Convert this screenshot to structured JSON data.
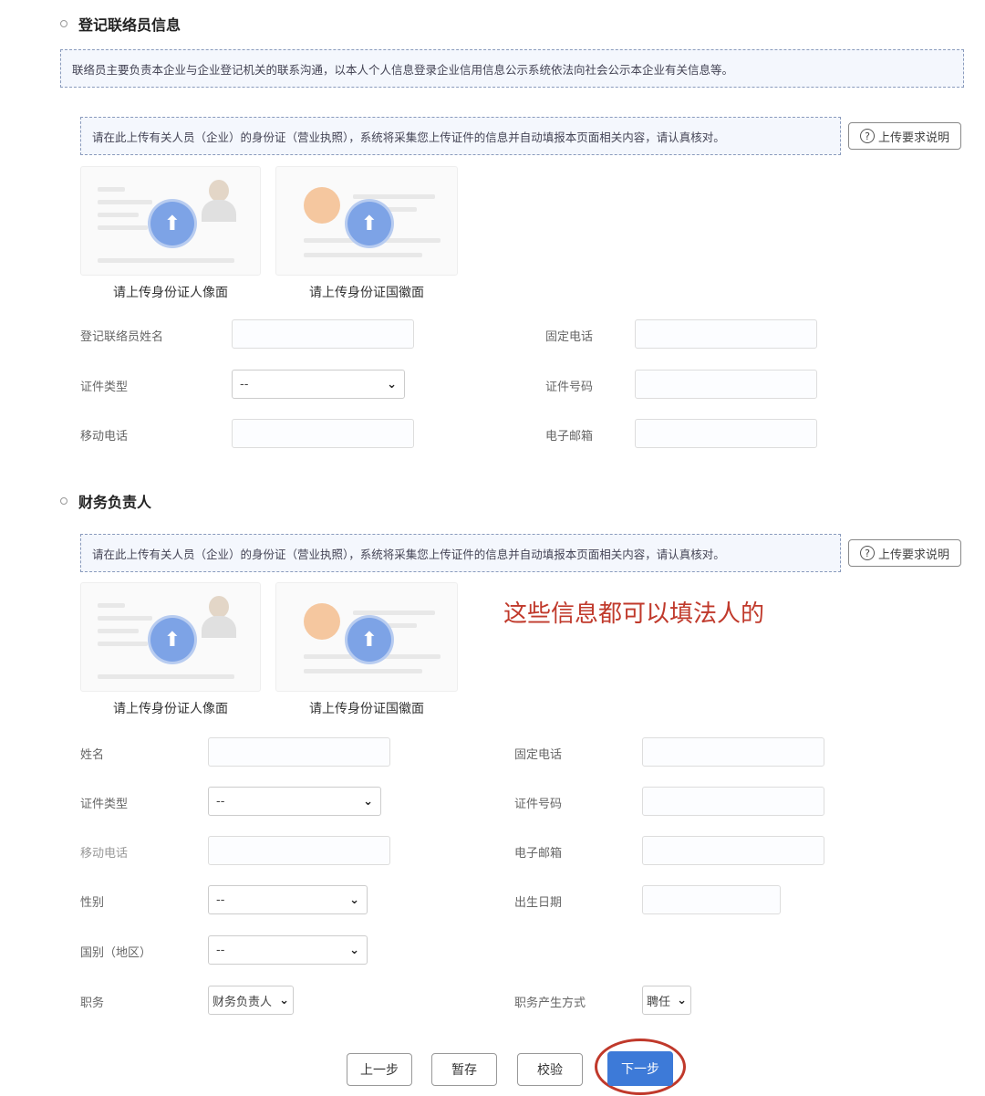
{
  "liaison": {
    "title": "登记联络员信息",
    "notice": "联络员主要负责本企业与企业登记机关的联系沟通，以本人个人信息登录企业信用信息公示系统依法向社会公示本企业有关信息等。",
    "upload_notice": "请在此上传有关人员（企业）的身份证（营业执照），系统将采集您上传证件的信息并自动填报本页面相关内容，请认真核对。",
    "help_label": "上传要求说明",
    "upload_front": "请上传身份证人像面",
    "upload_back": "请上传身份证国徽面",
    "fields": {
      "name": "登记联络员姓名",
      "landline": "固定电话",
      "id_type": "证件类型",
      "id_type_value": "--",
      "id_number": "证件号码",
      "mobile": "移动电话",
      "email": "电子邮箱"
    }
  },
  "finance": {
    "title": "财务负责人",
    "upload_notice": "请在此上传有关人员（企业）的身份证（营业执照），系统将采集您上传证件的信息并自动填报本页面相关内容，请认真核对。",
    "help_label": "上传要求说明",
    "upload_front": "请上传身份证人像面",
    "upload_back": "请上传身份证国徽面",
    "annotation": "这些信息都可以填法人的",
    "fields": {
      "name": "姓名",
      "landline": "固定电话",
      "id_type": "证件类型",
      "id_type_value": "--",
      "id_number": "证件号码",
      "mobile": "移动电话",
      "email": "电子邮箱",
      "gender": "性别",
      "gender_value": "--",
      "birth_date": "出生日期",
      "nationality": "国别（地区）",
      "nationality_value": "--",
      "position": "职务",
      "position_value": "财务负责人",
      "appointment": "职务产生方式",
      "appointment_value": "聘任"
    }
  },
  "actions": {
    "prev": "上一步",
    "save": "暂存",
    "verify": "校验",
    "next": "下一步"
  },
  "colors": {
    "primary": "#3d7ad8",
    "annotation": "#c0392b"
  }
}
